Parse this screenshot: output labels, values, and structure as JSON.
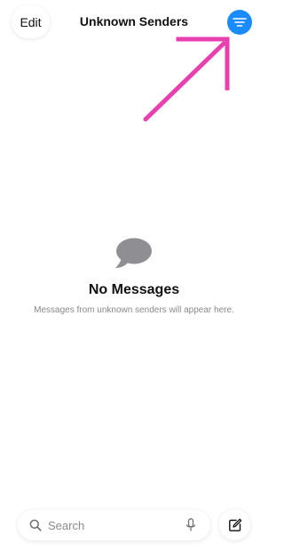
{
  "header": {
    "edit_label": "Edit",
    "title": "Unknown Senders",
    "filter_icon": "filter-lines-icon"
  },
  "empty_state": {
    "icon": "message-bubble-icon",
    "title": "No Messages",
    "subtitle": "Messages from unknown senders will appear here."
  },
  "bottom_bar": {
    "search_placeholder": "Search",
    "search_icon": "magnifying-glass-icon",
    "mic_icon": "microphone-icon",
    "compose_icon": "compose-icon"
  },
  "annotation": {
    "type": "arrow",
    "color": "#e940b0"
  },
  "colors": {
    "accent": "#1a8cff",
    "text": "#111111",
    "secondary_text": "#8a8a8e",
    "empty_icon": "#8e8e93"
  }
}
